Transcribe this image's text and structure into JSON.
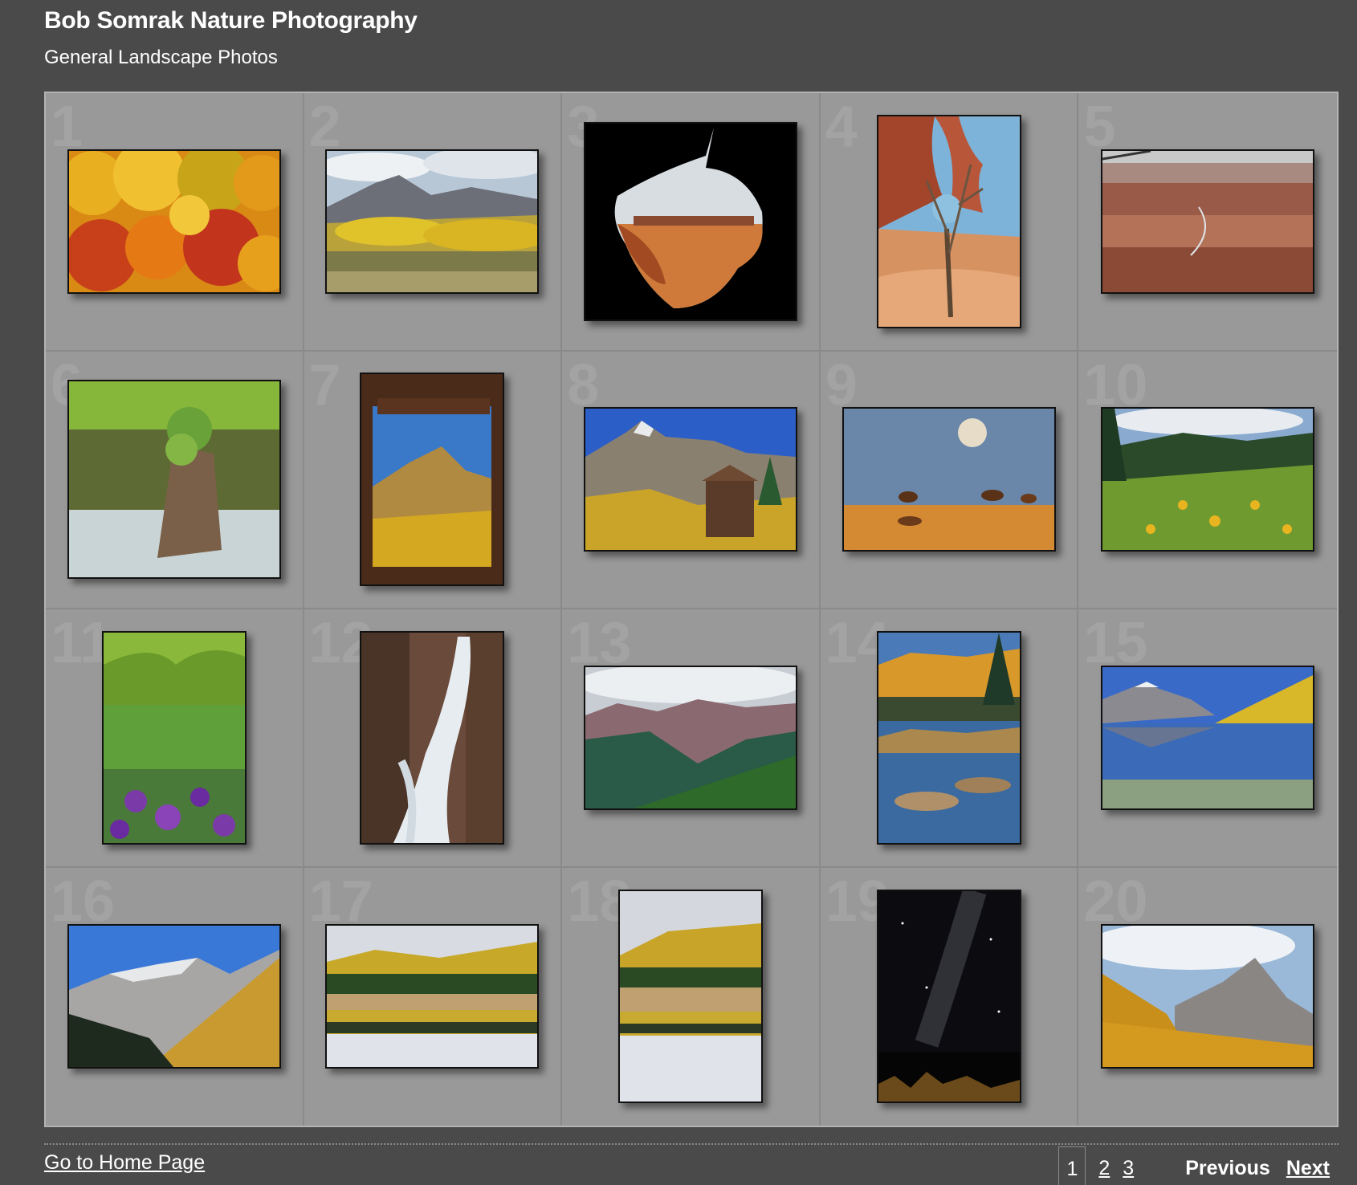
{
  "header": {
    "site_title": "Bob Somrak Nature Photography",
    "subtitle": "General Landscape Photos"
  },
  "gallery": {
    "cells": [
      {
        "num": "1"
      },
      {
        "num": "2"
      },
      {
        "num": "3"
      },
      {
        "num": "4"
      },
      {
        "num": "5"
      },
      {
        "num": "6"
      },
      {
        "num": "7"
      },
      {
        "num": "8"
      },
      {
        "num": "9"
      },
      {
        "num": "10"
      },
      {
        "num": "11"
      },
      {
        "num": "12"
      },
      {
        "num": "13"
      },
      {
        "num": "14"
      },
      {
        "num": "15"
      },
      {
        "num": "16"
      },
      {
        "num": "17"
      },
      {
        "num": "18"
      },
      {
        "num": "19"
      },
      {
        "num": "20"
      }
    ]
  },
  "footer": {
    "home_link": "Go to Home Page",
    "pages": [
      "1",
      "2",
      "3"
    ],
    "previous_label": "Previous",
    "next_label": "Next"
  }
}
